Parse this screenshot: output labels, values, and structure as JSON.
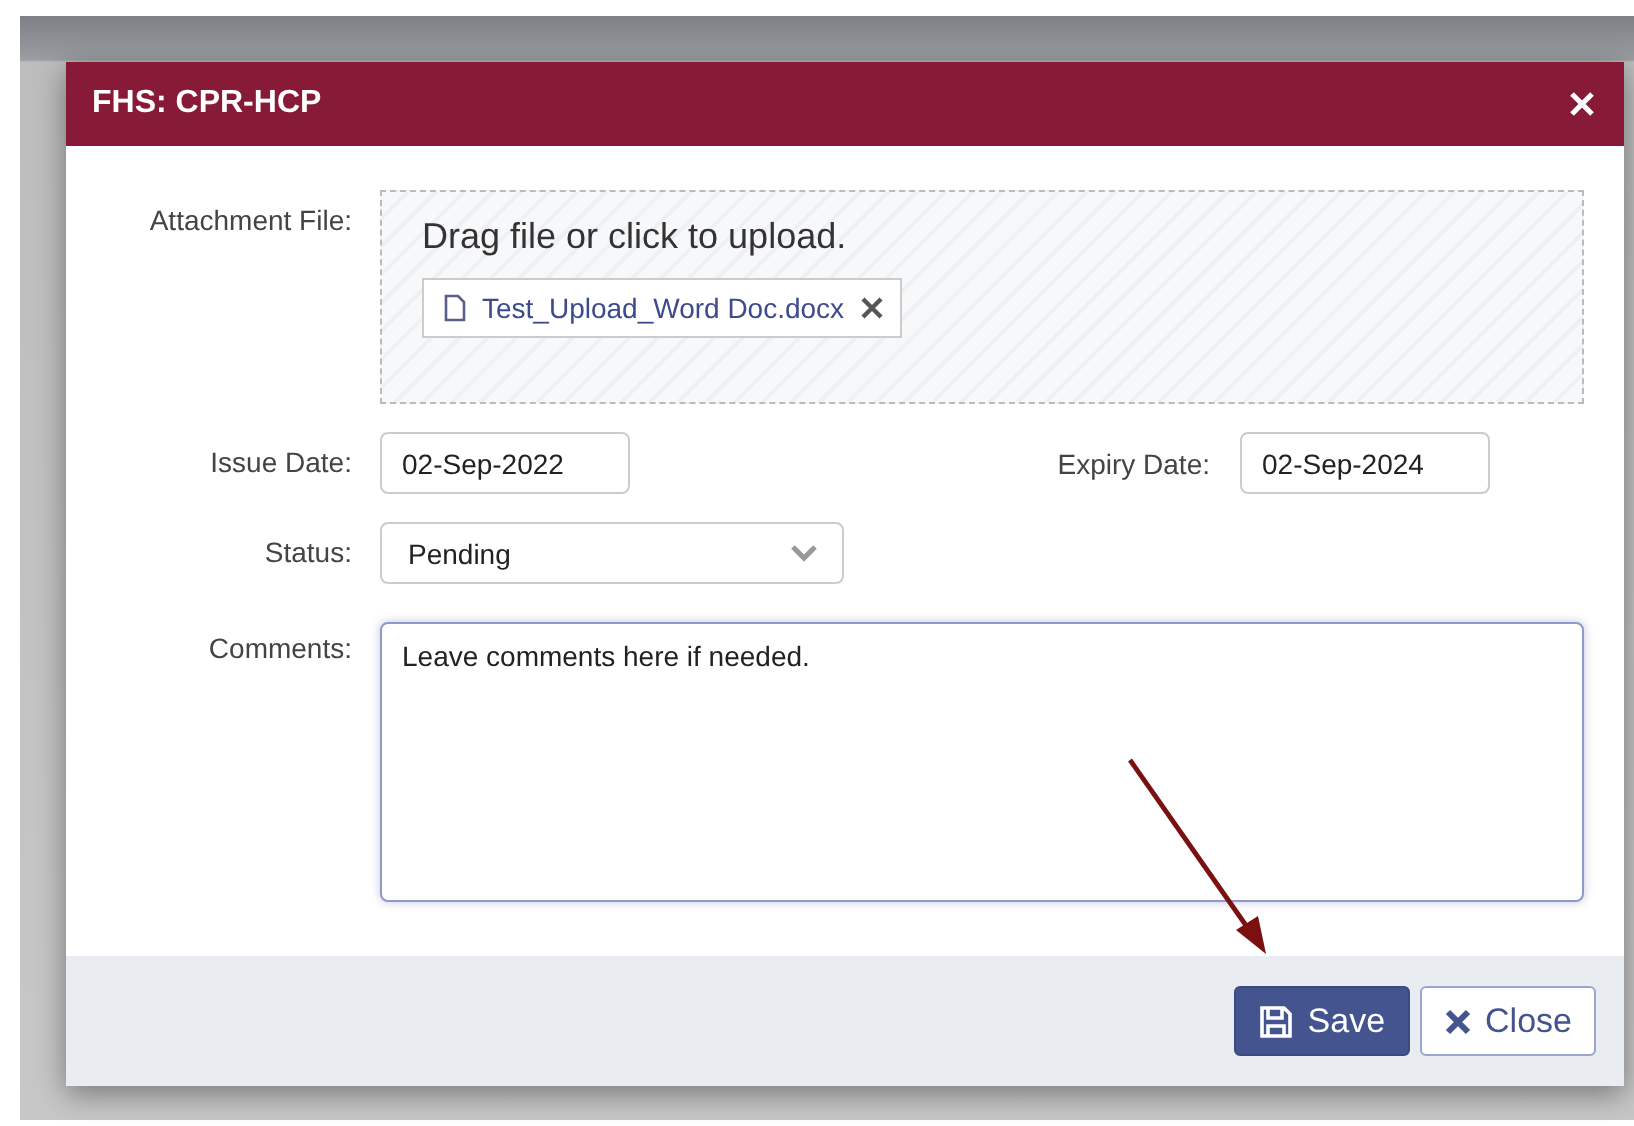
{
  "dialog": {
    "title": "FHS: CPR-HCP"
  },
  "attachment": {
    "label": "Attachment File:",
    "prompt": "Drag file or click to upload.",
    "files": [
      {
        "name": "Test_Upload_Word Doc.docx"
      }
    ]
  },
  "issue_date": {
    "label": "Issue Date:",
    "value": "02-Sep-2022"
  },
  "expiry_date": {
    "label": "Expiry Date:",
    "value": "02-Sep-2024"
  },
  "status": {
    "label": "Status:",
    "value": "Pending"
  },
  "comments": {
    "label": "Comments:",
    "value": "Leave comments here if needed."
  },
  "buttons": [
    {
      "label": "Save",
      "kind": "primary"
    },
    {
      "label": "Close",
      "kind": "secondary"
    }
  ]
}
